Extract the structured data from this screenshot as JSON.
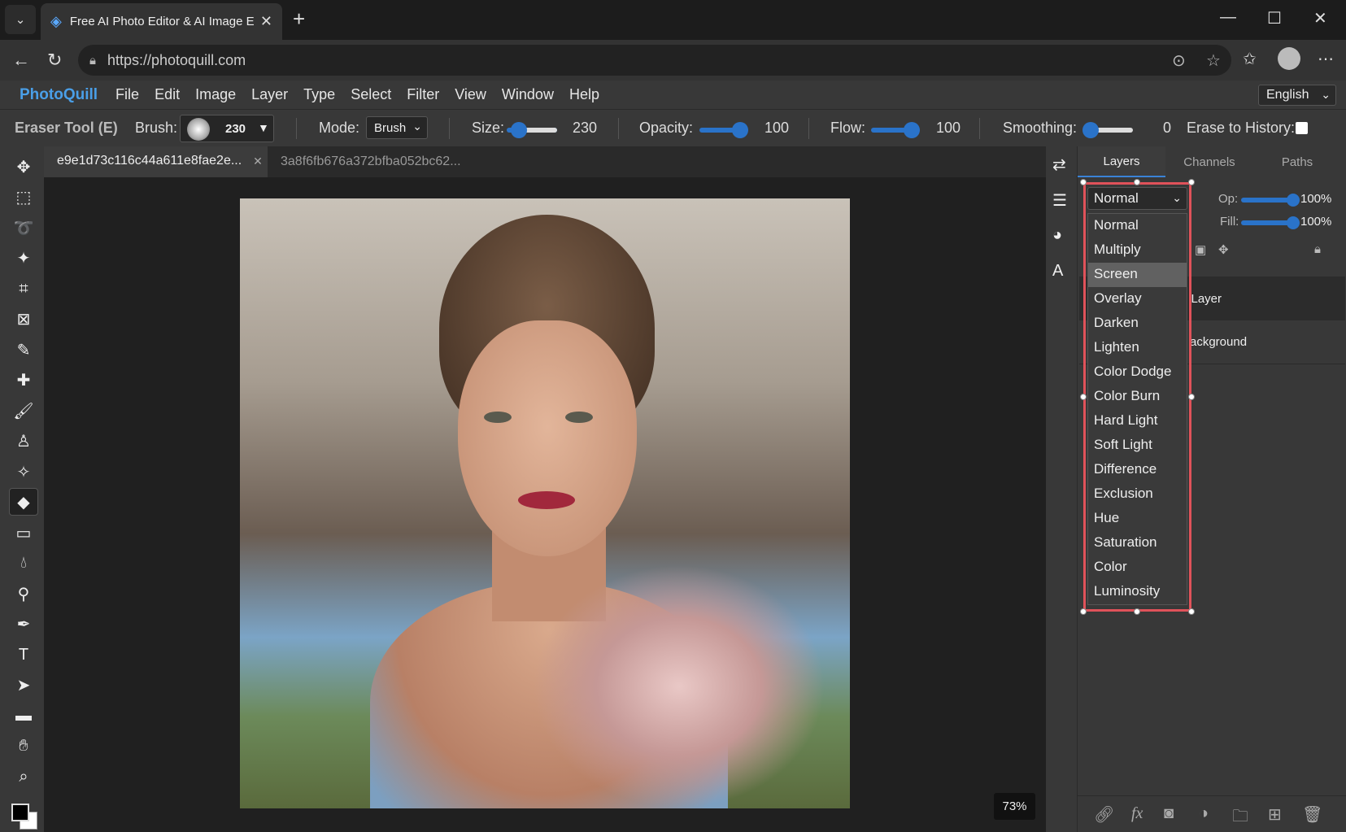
{
  "browser": {
    "tab_title": "Free AI Photo Editor & AI Image Ec",
    "url": "https://photoquill.com"
  },
  "app": {
    "brand": "PhotoQuill",
    "menu": [
      "File",
      "Edit",
      "Image",
      "Layer",
      "Type",
      "Select",
      "Filter",
      "View",
      "Window",
      "Help"
    ],
    "language": "English"
  },
  "options": {
    "tool_name": "Eraser Tool (E)",
    "brush_label": "Brush:",
    "brush_value": "230",
    "mode_label": "Mode:",
    "mode_value": "Brush",
    "size_label": "Size:",
    "size_value": "230",
    "opacity_label": "Opacity:",
    "opacity_value": "100",
    "flow_label": "Flow:",
    "flow_value": "100",
    "smoothing_label": "Smoothing:",
    "smoothing_value": "0",
    "erase_history_label": "Erase to History:"
  },
  "documents": {
    "tabs": [
      {
        "name": "e9e1d73c116c44a611e8fae2e...",
        "active": true
      },
      {
        "name": "3a8f6fb676a372bfba052bc62...",
        "active": false
      }
    ],
    "zoom": "73%"
  },
  "panel": {
    "tabs": [
      "Layers",
      "Channels",
      "Paths"
    ],
    "blend_mode": "Normal",
    "opacity_label": "Op:",
    "opacity_value": "100%",
    "fill_label": "Fill:",
    "fill_value": "100%",
    "layers": [
      {
        "name": "l Layer",
        "selected": true
      },
      {
        "name": "ackground",
        "selected": false
      }
    ]
  },
  "blend_options": [
    "Normal",
    "Multiply",
    "Screen",
    "Overlay",
    "Darken",
    "Lighten",
    "Color Dodge",
    "Color Burn",
    "Hard Light",
    "Soft Light",
    "Difference",
    "Exclusion",
    "Hue",
    "Saturation",
    "Color",
    "Luminosity"
  ],
  "blend_highlighted": "Screen",
  "colors": {
    "accent": "#3a82d6",
    "brand": "#4a9fe8",
    "highlight_frame": "#e0525a"
  }
}
